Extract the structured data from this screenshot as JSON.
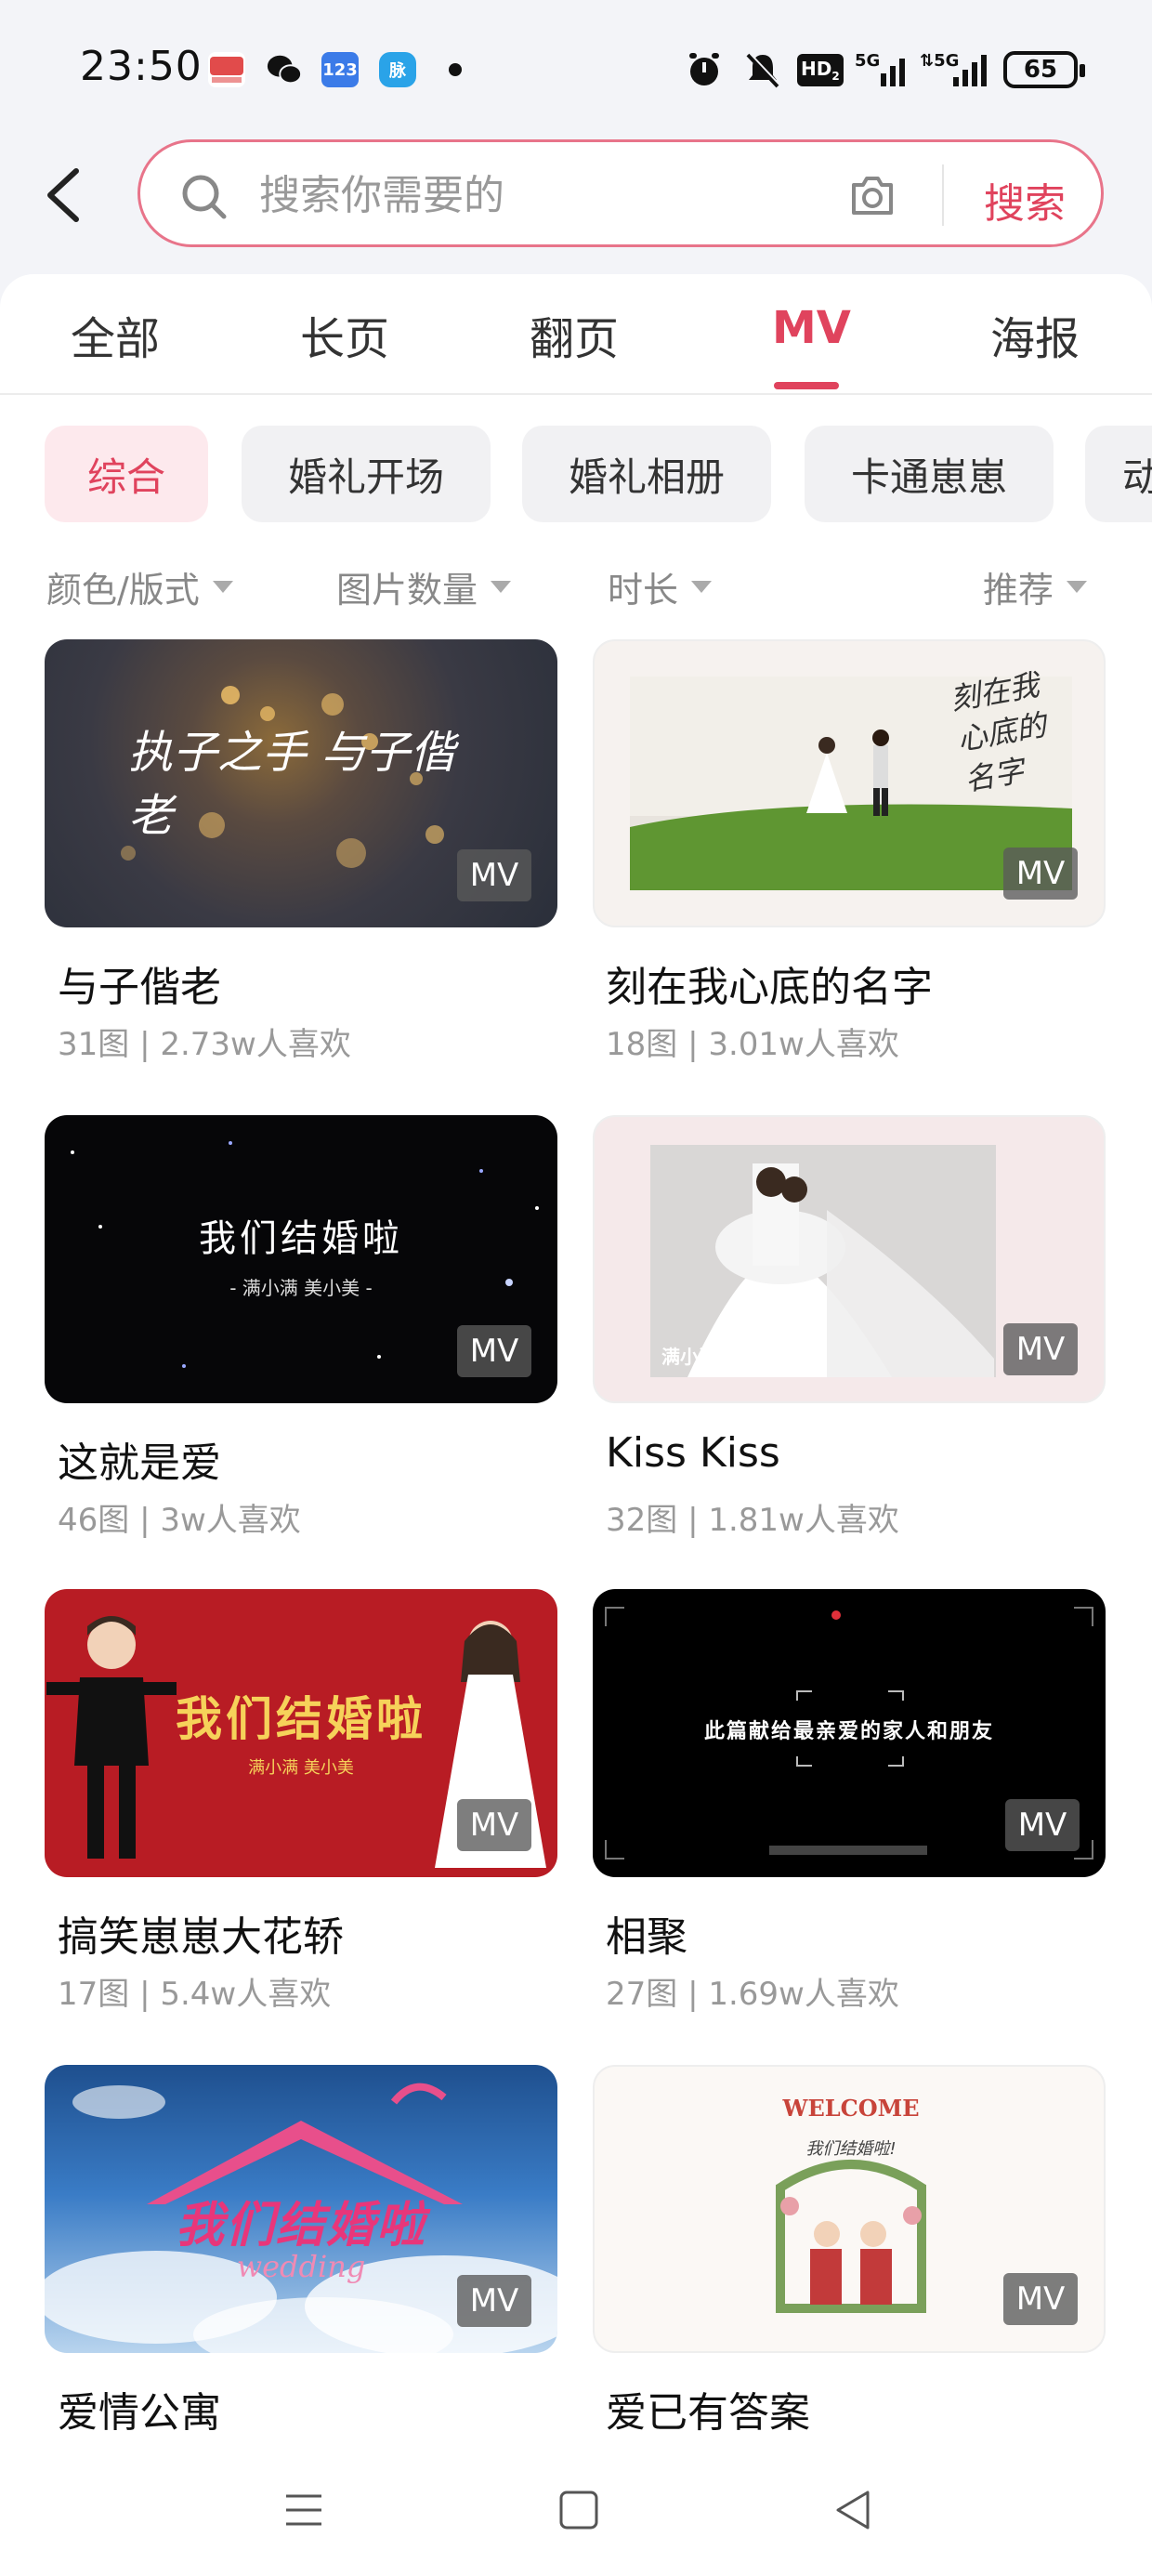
{
  "status_bar": {
    "time": "23:50",
    "battery": "65",
    "indicators": [
      "alarm-icon",
      "mute-icon",
      "HD2",
      "5G",
      "5G"
    ]
  },
  "search": {
    "placeholder": "搜索你需要的",
    "button_label": "搜索"
  },
  "tabs": [
    {
      "label": "全部",
      "active": false
    },
    {
      "label": "长页",
      "active": false
    },
    {
      "label": "翻页",
      "active": false
    },
    {
      "label": "MV",
      "active": true
    },
    {
      "label": "海报",
      "active": false
    }
  ],
  "chips": [
    {
      "label": "综合",
      "active": true
    },
    {
      "label": "婚礼开场",
      "active": false
    },
    {
      "label": "婚礼相册",
      "active": false
    },
    {
      "label": "卡通崽崽",
      "active": false
    },
    {
      "label": "动",
      "active": false
    }
  ],
  "filters": {
    "color_style": "颜色/版式",
    "image_count": "图片数量",
    "duration": "时长",
    "sort": "推荐"
  },
  "badge_label": "MV",
  "cards": [
    {
      "title": "与子偕老",
      "meta": "31图 | 2.73w人喜欢",
      "overlay": "执子之手 与子偕老"
    },
    {
      "title": "刻在我心底的名字",
      "meta": "18图 | 3.01w人喜欢",
      "overlay": "刻在我 心底的名字"
    },
    {
      "title": "这就是爱",
      "meta": "46图 | 3w人喜欢",
      "overlay": "我们结婚啦",
      "overlay_sub": "- 满小满 美小美 -"
    },
    {
      "title": "Kiss Kiss",
      "meta": "32图 | 1.81w人喜欢",
      "overlay": "满小满 and 美小美"
    },
    {
      "title": "搞笑崽崽大花轿",
      "meta": "17图 | 5.4w人喜欢",
      "overlay": "我们结婚啦",
      "overlay_sub": "满小满 美小美"
    },
    {
      "title": "相聚",
      "meta": "27图 | 1.69w人喜欢",
      "overlay": "此篇献给最亲爱的家人和朋友"
    },
    {
      "title": "爱情公寓",
      "meta": "",
      "overlay": "我们结婚啦",
      "overlay_sub": "wedding"
    },
    {
      "title": "爱已有答案",
      "meta": "",
      "overlay": "WELCOME",
      "overlay_sub": "我们结婚啦!"
    }
  ],
  "colors": {
    "accent": "#e0435d",
    "chip_active_bg": "#fde9ed",
    "header_bg": "#f3f4f8"
  }
}
